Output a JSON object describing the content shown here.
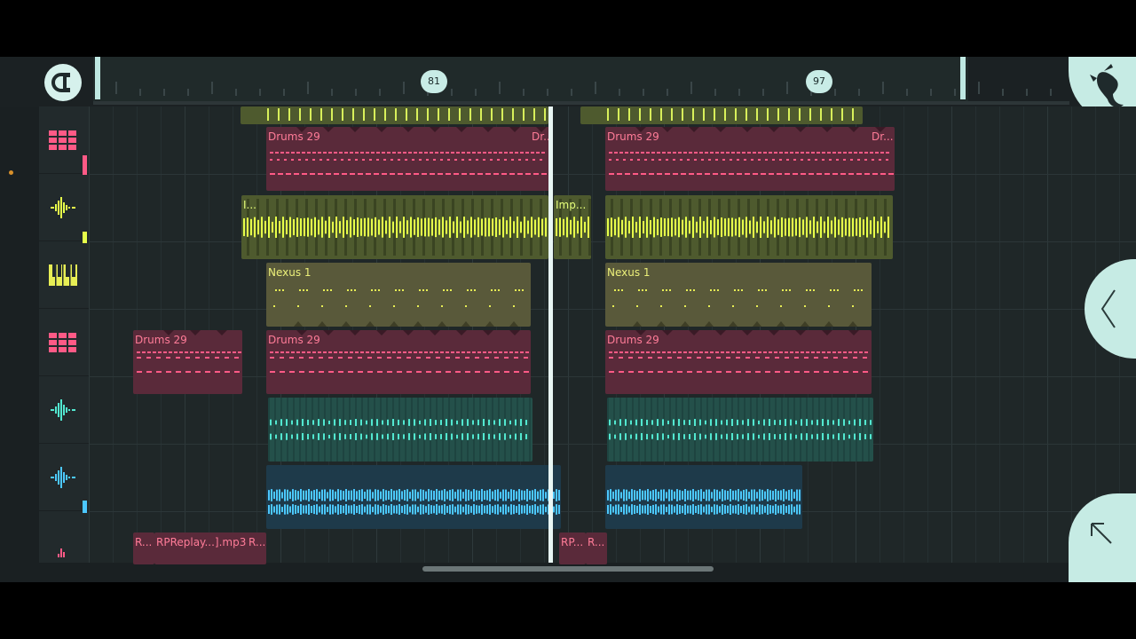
{
  "ruler": {
    "markers": [
      {
        "label": "81"
      },
      {
        "label": "97"
      }
    ]
  },
  "icons": {
    "snap": "magnet-icon",
    "logo": "fl-fruit-logo-icon",
    "collapse": "chevron-left-icon",
    "arrow": "arrow-up-left-icon"
  },
  "colors": {
    "accent": "#c6ebe4",
    "drums": "#ff5a86",
    "lime": "#e6ff4a",
    "nexus": "#e7ee55",
    "teal": "#52e8d0",
    "blue": "#4cc8ff"
  },
  "tracks": [
    {
      "icon": "drum-pads-icon"
    },
    {
      "icon": "audio-waveform-icon"
    },
    {
      "icon": "piano-keys-icon"
    },
    {
      "icon": "drum-pads-icon"
    },
    {
      "icon": "audio-waveform-icon"
    },
    {
      "icon": "audio-waveform-icon"
    },
    {
      "icon": "audio-waveform-icon"
    }
  ],
  "clips": {
    "drums_a1": "Drums 29",
    "drums_a1_end": "Dr...",
    "drums_a2": "Drums 29",
    "drums_a2_end": "Dr...",
    "imp_a": "I...",
    "imp_b": "Imp...",
    "nexus_1": "Nexus 1",
    "nexus_2": "Nexus 1",
    "drums_b1": "Drums 29",
    "drums_b2": "Drums 29",
    "drums_b3": "Drums 29",
    "replay_a": "R...",
    "replay_b": "RPReplay...].mp3",
    "replay_c": "R...",
    "replay_d": "RP...",
    "replay_e": "R..."
  }
}
